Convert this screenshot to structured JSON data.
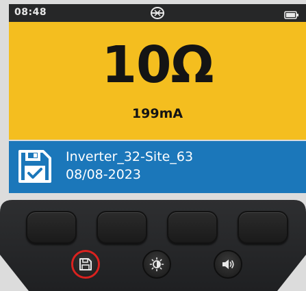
{
  "status_bar": {
    "time": "08:48",
    "logo_icon": "brand-logo-icon",
    "battery_icon": "battery-icon"
  },
  "reading": {
    "value": "10Ω",
    "secondary": "199mA"
  },
  "save_record": {
    "icon": "save-check-icon",
    "name": "Inverter_32-Site_63",
    "date": "08/08-2023"
  },
  "keypad": {
    "soft_keys": [
      "soft-key-1",
      "soft-key-2",
      "soft-key-3",
      "soft-key-4"
    ],
    "round_keys": [
      "save-icon",
      "brightness-icon",
      "volume-icon"
    ]
  },
  "colors": {
    "reading_panel": "#f4be1f",
    "save_panel": "#1b77ba",
    "status_bar": "#262728",
    "save_key_ring": "#d9221f"
  }
}
